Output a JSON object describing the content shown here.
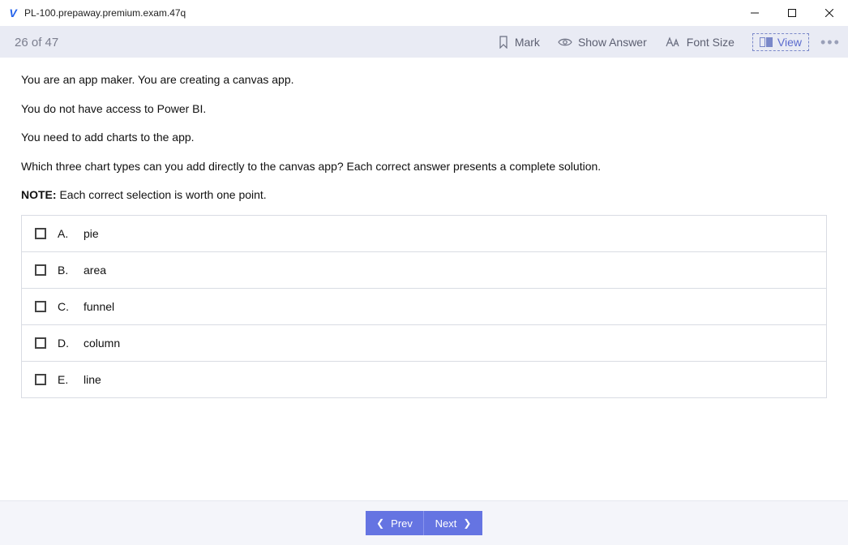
{
  "window": {
    "title": "PL-100.prepaway.premium.exam.47q"
  },
  "toolbar": {
    "position": "26 of 47",
    "mark": "Mark",
    "showAnswer": "Show Answer",
    "fontSize": "Font Size",
    "view": "View"
  },
  "question": {
    "p1": "You are an app maker. You are creating a canvas app.",
    "p2": "You do not have access to Power BI.",
    "p3": "You need to add charts to the app.",
    "p4": "Which three chart types can you add directly to the canvas app? Each correct answer presents a complete solution.",
    "noteLabel": "NOTE:",
    "noteText": " Each correct selection is worth one point."
  },
  "answers": [
    {
      "letter": "A.",
      "text": "pie"
    },
    {
      "letter": "B.",
      "text": "area"
    },
    {
      "letter": "C.",
      "text": "funnel"
    },
    {
      "letter": "D.",
      "text": "column"
    },
    {
      "letter": "E.",
      "text": "line"
    }
  ],
  "nav": {
    "prev": "Prev",
    "next": "Next"
  }
}
